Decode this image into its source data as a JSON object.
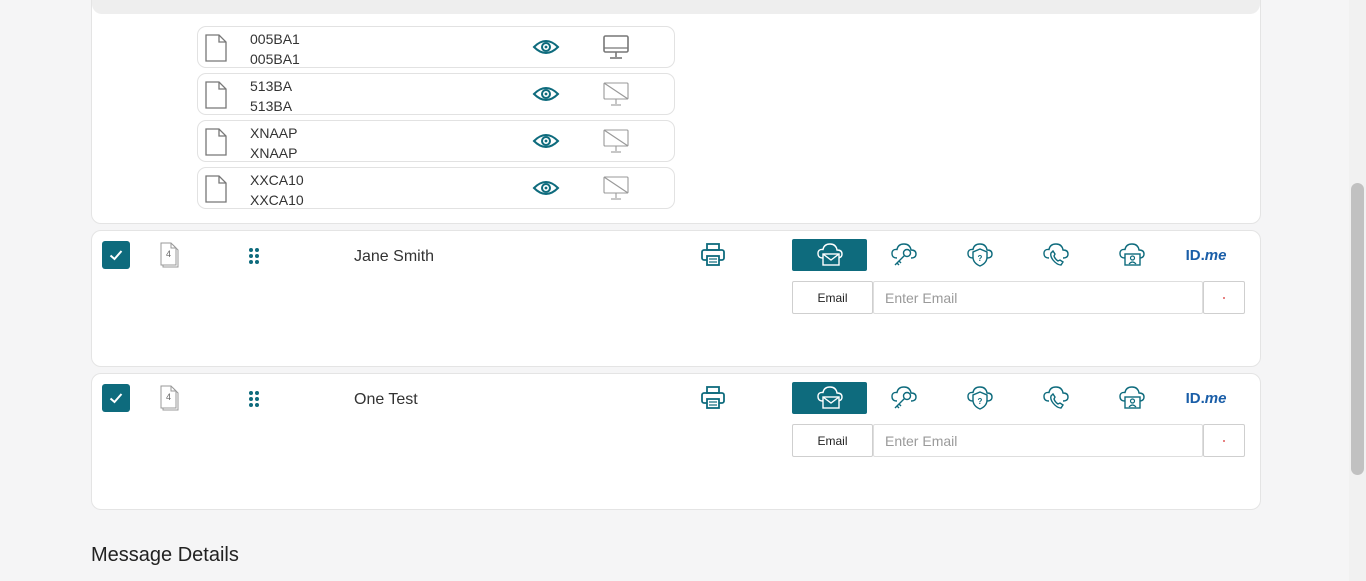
{
  "documents": [
    {
      "line1": "005BA1",
      "line2": "005BA1",
      "monitor_state": "enabled"
    },
    {
      "line1": "513BA",
      "line2": "513BA",
      "monitor_state": "disabled"
    },
    {
      "line1": "XNAAP",
      "line2": "XNAAP",
      "monitor_state": "disabled"
    },
    {
      "line1": "XXCA10",
      "line2": "XXCA10",
      "monitor_state": "disabled"
    }
  ],
  "recipients": [
    {
      "name": "Jane Smith",
      "checked": true,
      "doc_count": "4",
      "active_method": "email",
      "email_label": "Email",
      "email_placeholder": "Enter Email",
      "email_value": ""
    },
    {
      "name": "One Test",
      "checked": true,
      "doc_count": "4",
      "active_method": "email",
      "email_label": "Email",
      "email_placeholder": "Enter Email",
      "email_value": ""
    }
  ],
  "methods": [
    {
      "id": "email",
      "icon": "cloud-envelope-icon"
    },
    {
      "id": "access-code",
      "icon": "cloud-key-icon"
    },
    {
      "id": "kba",
      "icon": "shield-question-icon"
    },
    {
      "id": "phone",
      "icon": "cloud-phone-icon"
    },
    {
      "id": "id-check",
      "icon": "cloud-id-card-icon"
    },
    {
      "id": "idme",
      "icon": "idme-logo",
      "logo_text_id": "ID.",
      "logo_text_me": "me"
    }
  ],
  "message_details": {
    "title": "Message Details"
  },
  "colors": {
    "accent": "#0e6b7d",
    "idme": "#1a5ea8",
    "required": "#e05a5a"
  }
}
